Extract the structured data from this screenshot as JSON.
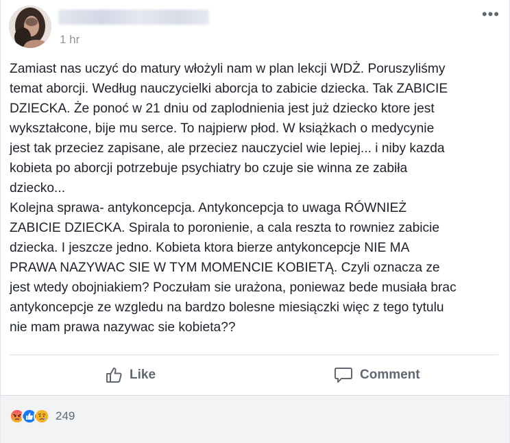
{
  "post": {
    "time": "1 hr",
    "more_label": "•••",
    "paragraphs": [
      "Zamiast nas uczyć do matury włożyli nam w plan lekcji WDŻ. Poruszyliśmy\ntemat aborcji. Według nauczycielki aborcja to zabicie dziecka. Tak ZABICIE\nDZIECKA. Że ponoć w 21 dniu od zaplodnienia jest już dziecko ktore jest\nwykształcone, bije mu serce. To najpierw płod. W książkach o medycynie\njest tak przeciez zapisane, ale przeciez nauczyciel wie lepiej... i niby kazda\nkobieta po aborcji potrzebuje psychiatry bo czuje sie winna ze zabiła\ndziecko...",
      "Kolejna sprawa- antykoncepcja. Antykoncepcja to uwaga RÓWNIEŻ\nZABICIE DZIECKA. Spirala to poronienie, a cala reszta to rowniez zabicie\ndziecka. I jeszcze jedno. Kobieta ktora bierze antykoncepcje NIE MA\nPRAWA NAZYWAC SIE W TYM MOMENCIE KOBIETĄ. Czyli oznacza ze\njest wtedy obojniakiem? Poczułam sie urażona, poniewaz bede musiała brac\nantykoncepcje ze wzgledu na bardzo bolesne miesiączki więc z tego tytulu\nnie mam prawa nazywac sie kobieta??"
    ]
  },
  "actions": {
    "like_label": "Like",
    "comment_label": "Comment"
  },
  "reactions": {
    "icons": [
      "angry-icon",
      "like-icon",
      "sad-icon"
    ],
    "count": "249"
  },
  "colors": {
    "text": "#1d2129",
    "secondary_text": "#606770",
    "meta_text": "#90949c",
    "like_blue": "#1877f2",
    "angry_red": "#e9710f",
    "sad_yellow": "#f7b125",
    "footer_bg": "#f2f3f5"
  }
}
